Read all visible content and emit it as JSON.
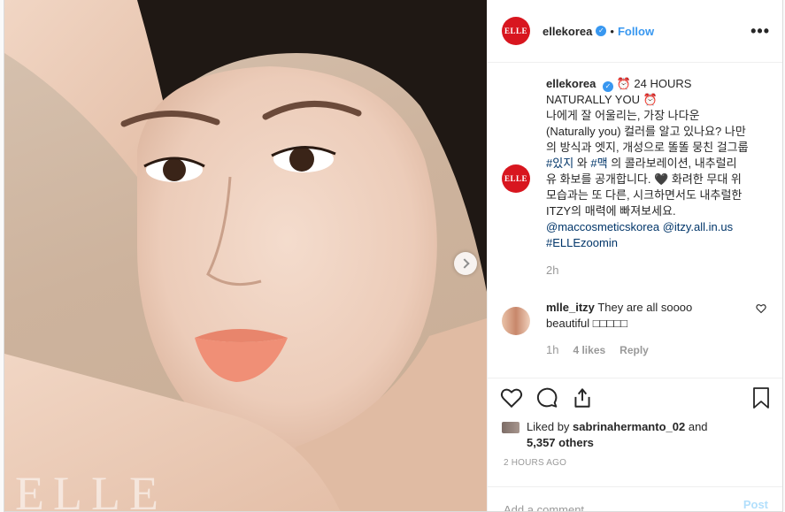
{
  "header": {
    "username": "ellekorea",
    "separator": "•",
    "follow_label": "Follow",
    "more_label": "•••",
    "avatar_text": "ELLE"
  },
  "photo": {
    "watermark": "ELLE",
    "next_label": "next"
  },
  "caption": {
    "username": "ellekorea",
    "line1": "⏰ 24 HOURS NATURALLY YOU ⏰",
    "line2": "나에게 잘 어울리는, 가장 나다운 (Naturally you) 컬러를 알고 있나요? 나만의 방식과 엣지, 개성으로 똘똘 뭉친 걸그룹",
    "hashtag1": "#있지",
    "wa": "와",
    "hashtag2": "#맥",
    "line3": "의 콜라보레이션, 내추럴리 유 화보를 공개합니다. 🖤 화려한 무대 위 모습과는 또 다른, 시크하면서도 내추럴한 ITZY의 매력에 빠져보세요.",
    "mention1": "@maccosmeticskorea",
    "mention2": "@itzy.all.in.us",
    "hashtag3": "#ELLEzoomin",
    "time": "2h"
  },
  "comment": {
    "username": "mlle_itzy",
    "text": "They are all soooo beautiful □□□□□",
    "time": "1h",
    "likes": "4 likes",
    "reply": "Reply"
  },
  "likes": {
    "prefix": "Liked by",
    "user": "sabrinahermanto_02",
    "and": "and",
    "others": "5,357 others"
  },
  "timestamp": "2 HOURS AGO",
  "add_comment": {
    "placeholder": "Add a comment...",
    "post_label": "Post"
  },
  "colors": {
    "accent": "#3897f0",
    "brand": "#d8161f",
    "link": "#003569",
    "muted": "#999999"
  }
}
